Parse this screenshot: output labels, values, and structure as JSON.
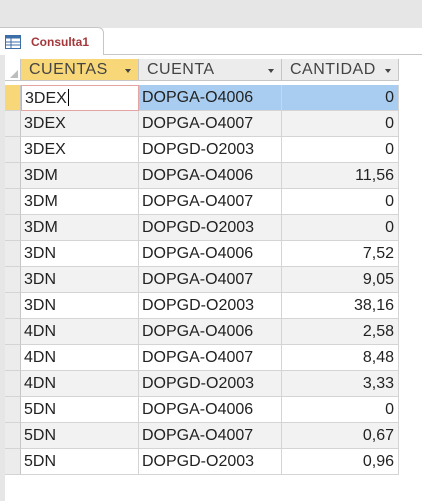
{
  "tab": {
    "label": "Consulta1",
    "icon": "query-table-icon"
  },
  "columns": [
    {
      "label": "CUENTAS",
      "selected": true
    },
    {
      "label": "CUENTA",
      "selected": false
    },
    {
      "label": "CANTIDAD",
      "selected": false
    }
  ],
  "rows": [
    {
      "cuentas": "3DEX",
      "cuenta": "DOPGA-O4006",
      "cantidad": "0"
    },
    {
      "cuentas": "3DEX",
      "cuenta": "DOPGA-O4007",
      "cantidad": "0"
    },
    {
      "cuentas": "3DEX",
      "cuenta": "DOPGD-O2003",
      "cantidad": "0"
    },
    {
      "cuentas": "3DM",
      "cuenta": "DOPGA-O4006",
      "cantidad": "11,56"
    },
    {
      "cuentas": "3DM",
      "cuenta": "DOPGA-O4007",
      "cantidad": "0"
    },
    {
      "cuentas": "3DM",
      "cuenta": "DOPGD-O2003",
      "cantidad": "0"
    },
    {
      "cuentas": "3DN",
      "cuenta": "DOPGA-O4006",
      "cantidad": "7,52"
    },
    {
      "cuentas": "3DN",
      "cuenta": "DOPGA-O4007",
      "cantidad": "9,05"
    },
    {
      "cuentas": "3DN",
      "cuenta": "DOPGD-O2003",
      "cantidad": "38,16"
    },
    {
      "cuentas": "4DN",
      "cuenta": "DOPGA-O4006",
      "cantidad": "2,58"
    },
    {
      "cuentas": "4DN",
      "cuenta": "DOPGA-O4007",
      "cantidad": "8,48"
    },
    {
      "cuentas": "4DN",
      "cuenta": "DOPGD-O2003",
      "cantidad": "3,33"
    },
    {
      "cuentas": "5DN",
      "cuenta": "DOPGA-O4006",
      "cantidad": "0"
    },
    {
      "cuentas": "5DN",
      "cuenta": "DOPGA-O4007",
      "cantidad": "0,67"
    },
    {
      "cuentas": "5DN",
      "cuenta": "DOPGD-O2003",
      "cantidad": "0,96"
    }
  ],
  "colors": {
    "tab_text": "#a4373a",
    "selected_header": "#f7d778",
    "selected_row": "#a9cdf0",
    "alt_row": "#f2f2f2"
  }
}
